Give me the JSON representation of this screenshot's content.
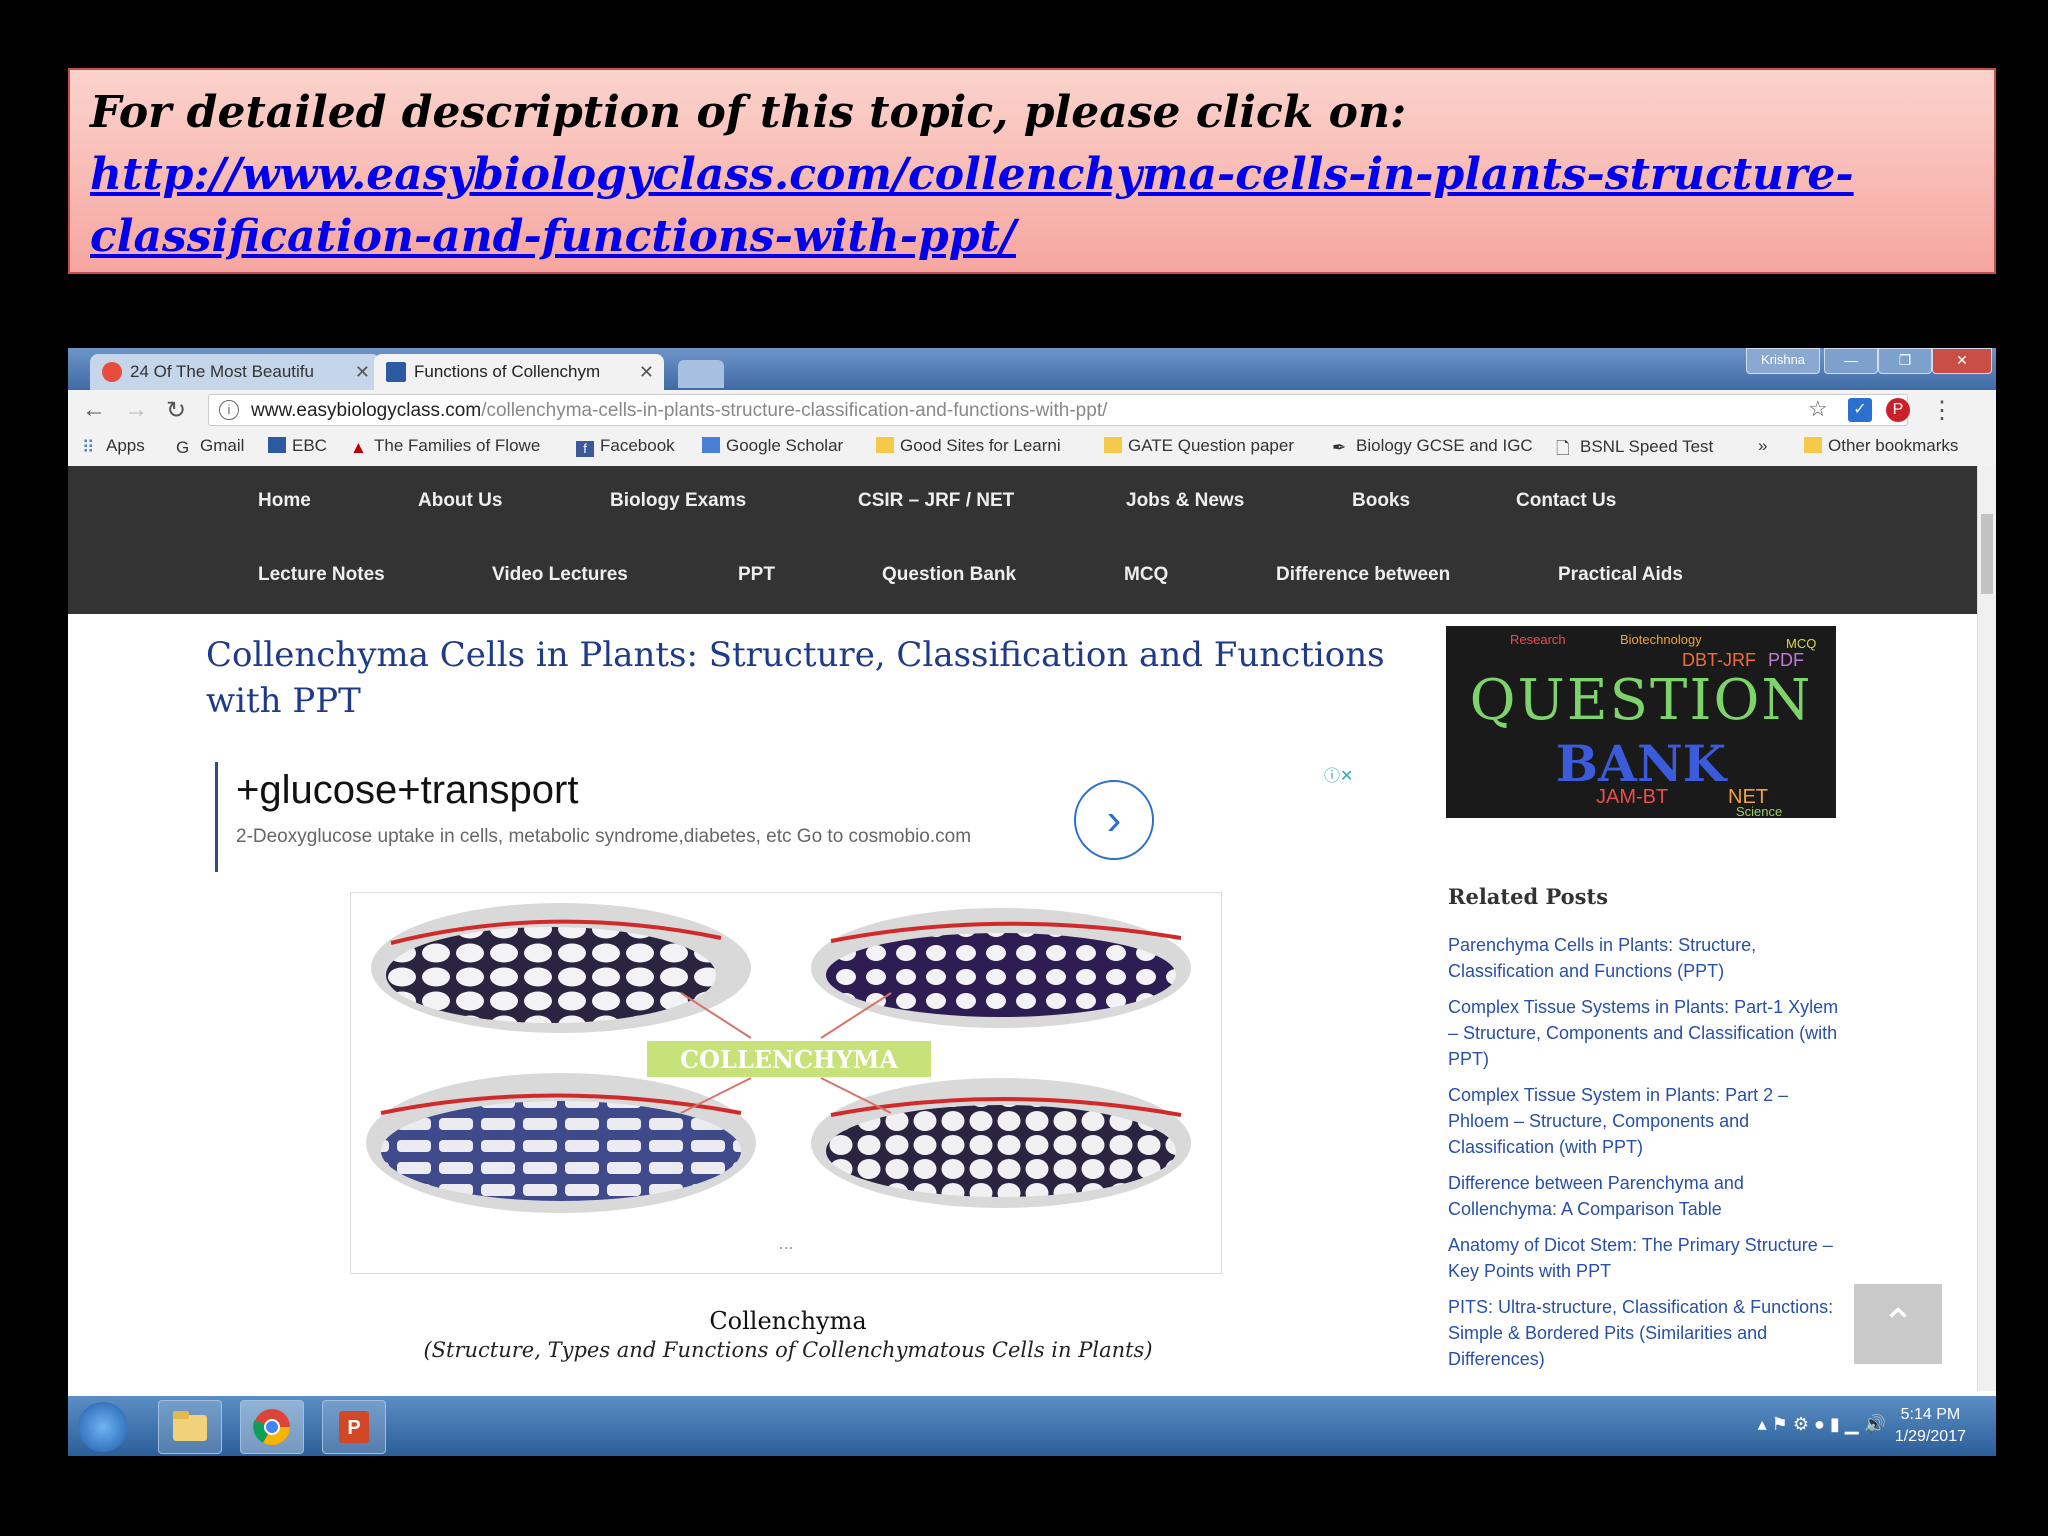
{
  "banner": {
    "line1": "For detailed description of this topic, please click on:",
    "link_line1": "http://www.easybiologyclass.com/collenchyma-cells-in-plants-structure-",
    "link_line2": "classification-and-functions-with-ppt/"
  },
  "browser": {
    "tabs": [
      {
        "label": "24 Of The Most Beautifu"
      },
      {
        "label": "Functions of Collenchym"
      }
    ],
    "user": "Krishna",
    "url_domain": "www.easybiologyclass.com",
    "url_path": "/collenchyma-cells-in-plants-structure-classification-and-functions-with-ppt/",
    "bookmarks": [
      "Apps",
      "Gmail",
      "EBC",
      "The Families of Flowe",
      "Facebook",
      "Google Scholar",
      "Good Sites for Learni",
      "GATE Question paper",
      "Biology GCSE and IGC",
      "BSNL Speed Test",
      "»",
      "Other bookmarks"
    ]
  },
  "site_nav": {
    "row1": [
      "Home",
      "About Us",
      "Biology Exams",
      "CSIR – JRF / NET",
      "Jobs & News",
      "Books",
      "Contact Us"
    ],
    "row2": [
      "Lecture Notes",
      "Video Lectures",
      "PPT",
      "Question Bank",
      "MCQ",
      "Difference between",
      "Practical Aids"
    ]
  },
  "article": {
    "title": "Collenchyma Cells in Plants: Structure, Classification and Functions with PPT",
    "ad_headline": "+glucose+transport",
    "ad_desc": "2-Deoxyglucose uptake in cells, metabolic syndrome,diabetes, etc Go to cosmobio.com",
    "figure_label": "COLLENCHYMA",
    "figure_more": "...",
    "caption": "Collenchyma",
    "caption_sub": "(Structure, Types and Functions of Collenchymatous Cells in Plants)"
  },
  "sidebar": {
    "qbank_line1": "QUESTION",
    "qbank_line2": "BANK",
    "qbank_words": [
      "Research",
      "Biotechnology",
      "DBT-JRF",
      "PDF",
      "MCQ",
      "JAM-BT",
      "NET",
      "Science"
    ],
    "related_heading": "Related Posts",
    "related": [
      "Parenchyma Cells in Plants: Structure, Classification and Functions (PPT)",
      "Complex Tissue Systems in Plants: Part-1 Xylem – Structure, Components and Classification (with PPT)",
      "Complex Tissue System in Plants: Part 2 – Phloem – Structure, Components and Classification (with PPT)",
      "Difference between Parenchyma and Collenchyma: A Comparison Table",
      "Anatomy of Dicot Stem: The Primary Structure – Key Points with PPT",
      "PITS: Ultra-structure, Classification & Functions: Simple & Bordered Pits (Similarities and Differences)"
    ]
  },
  "taskbar": {
    "time": "5:14 PM",
    "date": "1/29/2017"
  }
}
